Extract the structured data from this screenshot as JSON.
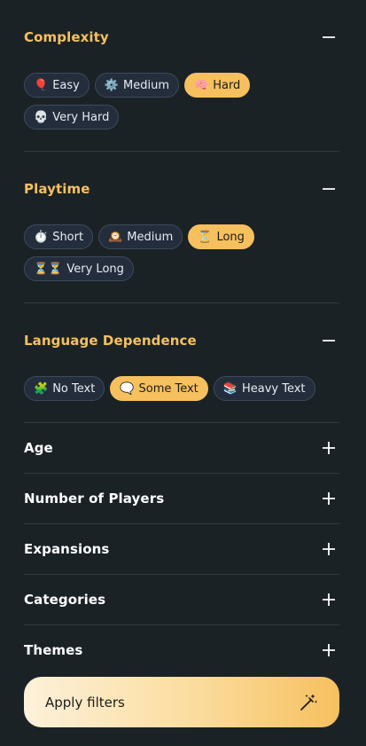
{
  "sections": [
    {
      "title": "Complexity",
      "expanded": true,
      "options": [
        {
          "emoji": "🎈",
          "label": "Easy",
          "selected": false
        },
        {
          "emoji": "⚙️",
          "label": "Medium",
          "selected": false
        },
        {
          "emoji": "🧠",
          "label": "Hard",
          "selected": true
        },
        {
          "emoji": "💀",
          "label": "Very Hard",
          "selected": false
        }
      ]
    },
    {
      "title": "Playtime",
      "expanded": true,
      "options": [
        {
          "emoji": "⏱️",
          "label": "Short",
          "selected": false
        },
        {
          "emoji": "🕰️",
          "label": "Medium",
          "selected": false
        },
        {
          "emoji": "⏳",
          "label": "Long",
          "selected": true
        },
        {
          "emoji": "⏳⏳",
          "label": "Very Long",
          "selected": false
        }
      ]
    },
    {
      "title": "Language Dependence",
      "expanded": true,
      "options": [
        {
          "emoji": "🧩",
          "label": "No Text",
          "selected": false
        },
        {
          "emoji": "🗨️",
          "label": "Some Text",
          "selected": true
        },
        {
          "emoji": "📚",
          "label": "Heavy Text",
          "selected": false
        }
      ]
    },
    {
      "title": "Age",
      "expanded": false
    },
    {
      "title": "Number of Players",
      "expanded": false
    },
    {
      "title": "Expansions",
      "expanded": false
    },
    {
      "title": "Categories",
      "expanded": false
    },
    {
      "title": "Themes",
      "expanded": false
    }
  ],
  "apply_button": {
    "label": "Apply filters",
    "icon": "magic-wand-icon"
  },
  "colors": {
    "background": "#1b2226",
    "accent": "#f6c05f",
    "chip_background": "#232d3c",
    "chip_border": "#3d4a5b",
    "divider": "#323b41"
  }
}
